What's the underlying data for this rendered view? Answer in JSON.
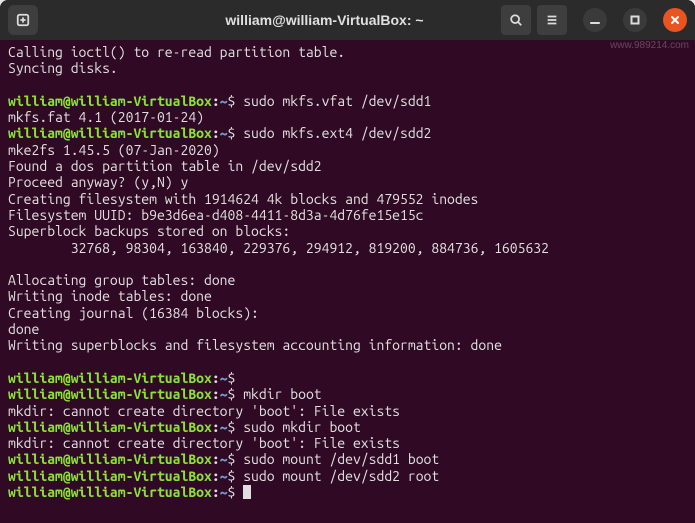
{
  "titlebar": {
    "title": "william@william-VirtualBox: ~"
  },
  "prompt": {
    "user": "william@william-VirtualBox",
    "colon": ":",
    "path": "~",
    "symbol": "$"
  },
  "lines": [
    {
      "t": "out",
      "text": "Calling ioctl() to re-read partition table."
    },
    {
      "t": "out",
      "text": "Syncing disks."
    },
    {
      "t": "blank"
    },
    {
      "t": "cmd",
      "text": "sudo mkfs.vfat /dev/sdd1"
    },
    {
      "t": "out",
      "text": "mkfs.fat 4.1 (2017-01-24)"
    },
    {
      "t": "cmd",
      "text": "sudo mkfs.ext4 /dev/sdd2"
    },
    {
      "t": "out",
      "text": "mke2fs 1.45.5 (07-Jan-2020)"
    },
    {
      "t": "out",
      "text": "Found a dos partition table in /dev/sdd2"
    },
    {
      "t": "out",
      "text": "Proceed anyway? (y,N) y"
    },
    {
      "t": "out",
      "text": "Creating filesystem with 1914624 4k blocks and 479552 inodes"
    },
    {
      "t": "out",
      "text": "Filesystem UUID: b9e3d6ea-d408-4411-8d3a-4d76fe15e15c"
    },
    {
      "t": "out",
      "text": "Superblock backups stored on blocks:"
    },
    {
      "t": "out",
      "text": "        32768, 98304, 163840, 229376, 294912, 819200, 884736, 1605632"
    },
    {
      "t": "blank"
    },
    {
      "t": "out",
      "text": "Allocating group tables: done"
    },
    {
      "t": "out",
      "text": "Writing inode tables: done"
    },
    {
      "t": "out",
      "text": "Creating journal (16384 blocks):"
    },
    {
      "t": "out",
      "text": "done"
    },
    {
      "t": "out",
      "text": "Writing superblocks and filesystem accounting information: done"
    },
    {
      "t": "blank"
    },
    {
      "t": "cmd",
      "text": ""
    },
    {
      "t": "cmd",
      "text": "mkdir boot"
    },
    {
      "t": "out",
      "text": "mkdir: cannot create directory 'boot': File exists"
    },
    {
      "t": "cmd",
      "text": "sudo mkdir boot"
    },
    {
      "t": "out",
      "text": "mkdir: cannot create directory 'boot': File exists"
    },
    {
      "t": "cmd",
      "text": "sudo mount /dev/sdd1 boot"
    },
    {
      "t": "cmd",
      "text": "sudo mount /dev/sdd2 root"
    },
    {
      "t": "cursor"
    }
  ],
  "watermark": "www.989214.com"
}
